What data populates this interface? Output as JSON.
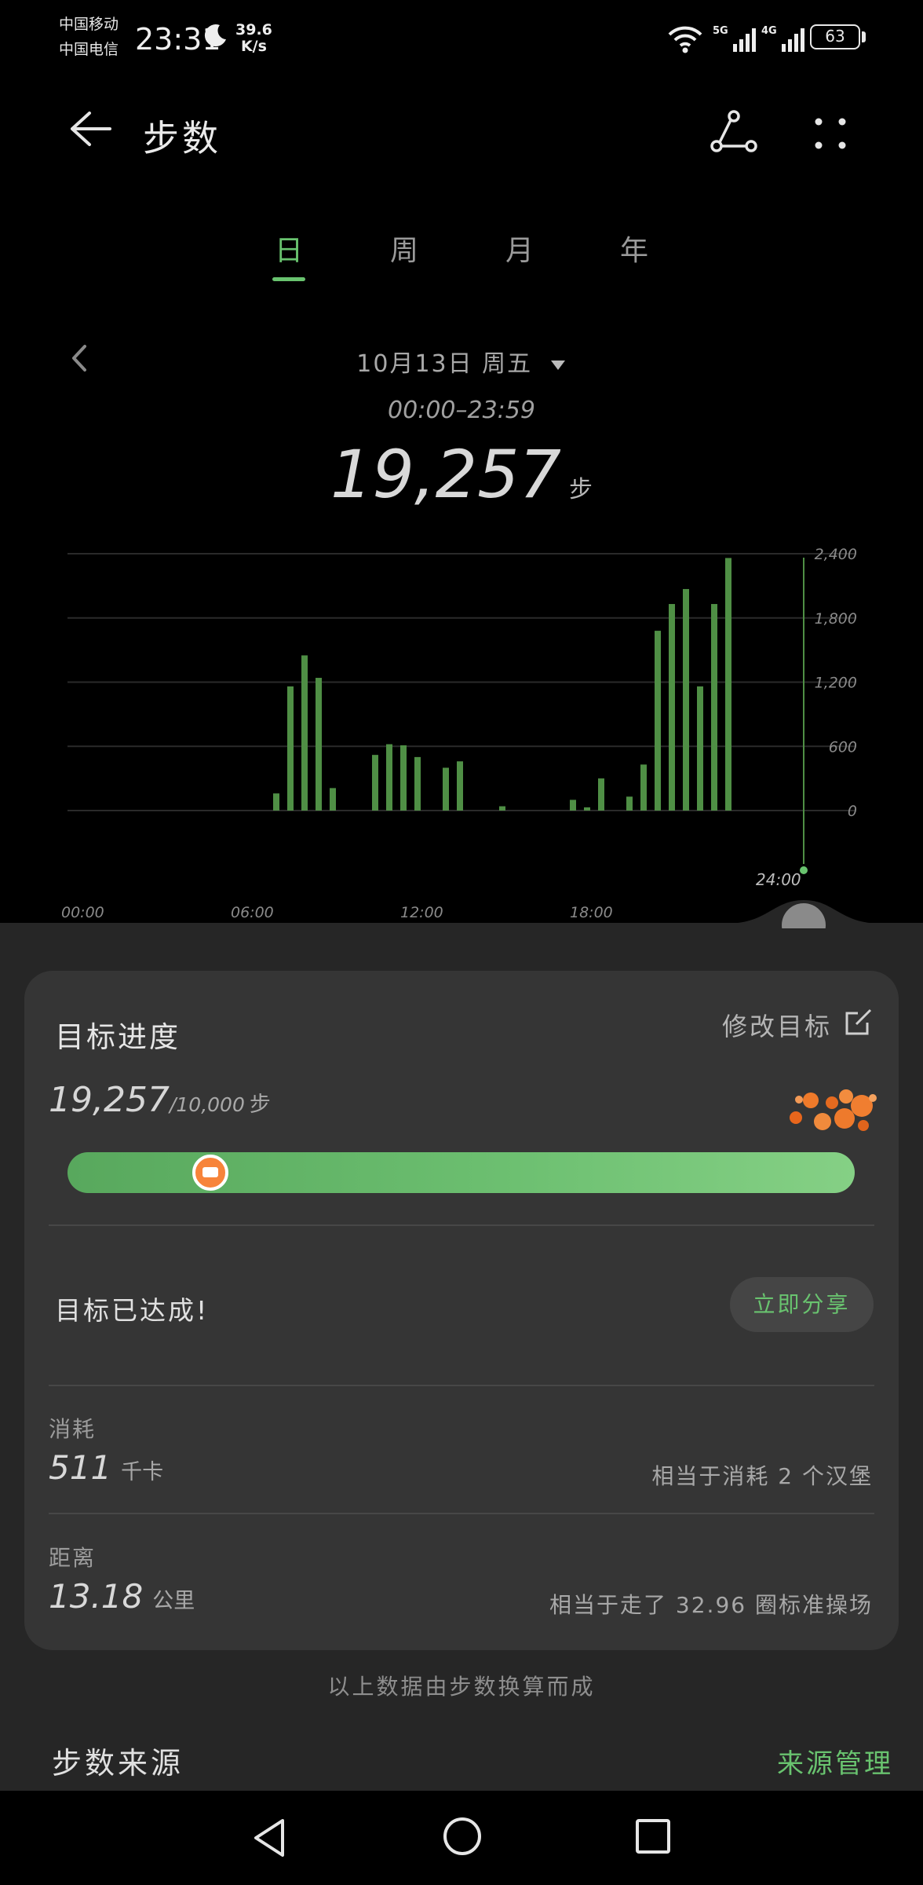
{
  "status_bar": {
    "carrier1": "中国移动",
    "carrier2": "中国电信",
    "time": "23:31",
    "net_speed_value": "39.6",
    "net_speed_unit": "K/s",
    "signal1_label": "5G",
    "signal2_label": "4G",
    "battery": "63"
  },
  "header": {
    "title": "步数"
  },
  "tabs": [
    {
      "label": "日",
      "active": true
    },
    {
      "label": "周",
      "active": false
    },
    {
      "label": "月",
      "active": false
    },
    {
      "label": "年",
      "active": false
    }
  ],
  "date_nav": {
    "date": "10月13日 周五",
    "time_range": "00:00–23:59",
    "total": "19,257",
    "unit": "步"
  },
  "chart_data": {
    "type": "bar",
    "x_ticks": [
      "00:00",
      "06:00",
      "12:00",
      "18:00"
    ],
    "cursor_label": "24:00",
    "y_ticks": [
      "2,400",
      "1,800",
      "1,200",
      "600",
      "0"
    ],
    "ylim": [
      0,
      2400
    ],
    "grid": true,
    "color": "#4f8f45",
    "bars": [
      {
        "hour": 7.0,
        "value": 160
      },
      {
        "hour": 7.5,
        "value": 1160
      },
      {
        "hour": 8.0,
        "value": 1450
      },
      {
        "hour": 8.5,
        "value": 1240
      },
      {
        "hour": 9.0,
        "value": 210
      },
      {
        "hour": 10.5,
        "value": 520
      },
      {
        "hour": 11.0,
        "value": 620
      },
      {
        "hour": 11.5,
        "value": 610
      },
      {
        "hour": 12.0,
        "value": 500
      },
      {
        "hour": 13.0,
        "value": 400
      },
      {
        "hour": 13.5,
        "value": 460
      },
      {
        "hour": 15.0,
        "value": 40
      },
      {
        "hour": 17.5,
        "value": 100
      },
      {
        "hour": 18.0,
        "value": 30
      },
      {
        "hour": 18.5,
        "value": 300
      },
      {
        "hour": 19.5,
        "value": 130
      },
      {
        "hour": 20.0,
        "value": 430
      },
      {
        "hour": 20.5,
        "value": 1680
      },
      {
        "hour": 21.0,
        "value": 1930
      },
      {
        "hour": 21.5,
        "value": 2070
      },
      {
        "hour": 22.0,
        "value": 1160
      },
      {
        "hour": 22.5,
        "value": 1930
      },
      {
        "hour": 23.0,
        "value": 2360
      }
    ]
  },
  "goal": {
    "title": "目标进度",
    "modify_label": "修改目标",
    "steps": "19,257",
    "goal_text": "/10,000",
    "unit": "步",
    "progress": 1.0,
    "knob_position": 0.18,
    "reached_text": "目标已达成!",
    "share_label": "立即分享"
  },
  "calories": {
    "label": "消耗",
    "value": "511",
    "unit": "千卡",
    "compare": "相当于消耗 2 个汉堡"
  },
  "distance": {
    "label": "距离",
    "value": "13.18",
    "unit": "公里",
    "compare": "相当于走了 32.96 圈标准操场"
  },
  "footnote": "以上数据由步数换算而成",
  "source": {
    "title": "步数来源",
    "manage_label": "来源管理"
  },
  "colors": {
    "accent": "#69c36f",
    "bar": "#4f8f45",
    "panel": "#353535"
  }
}
